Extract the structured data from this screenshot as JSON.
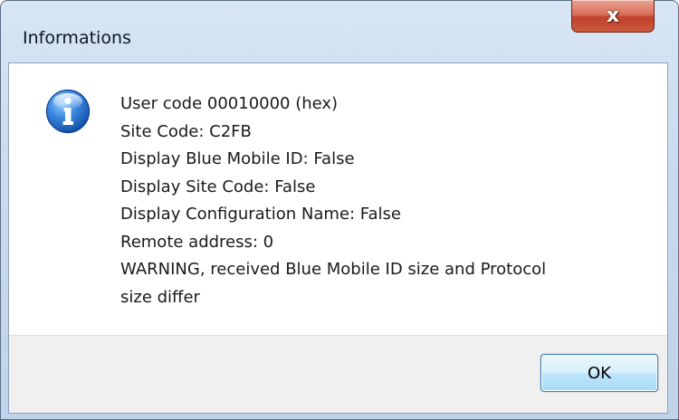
{
  "window": {
    "title": "Informations"
  },
  "title_bar": {
    "close_label": "x",
    "close_color": "#c7472f"
  },
  "dialog": {
    "icon": "information-icon",
    "icon_color": "#1f66c2",
    "message_lines": [
      "User code 00010000 (hex)",
      "Site Code: C2FB",
      "Display Blue Mobile ID: False",
      "Display Site Code: False",
      "Display Configuration Name: False",
      "Remote address: 0",
      "WARNING, received Blue Mobile ID size and Protocol",
      "size differ"
    ]
  },
  "footer": {
    "ok_label": "OK"
  }
}
